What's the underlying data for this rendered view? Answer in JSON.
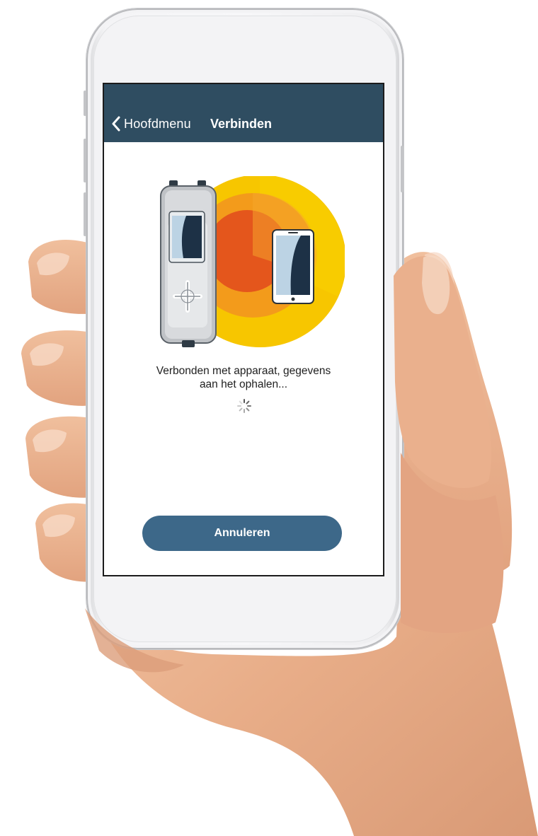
{
  "navbar": {
    "back_label": "Hoofdmenu",
    "title": "Verbinden",
    "background_color": "#2f4d61"
  },
  "main": {
    "status_line_1": "Verbonden met apparaat, gegevens",
    "status_line_2": "aan het ophalen...",
    "cancel_label": "Annuleren",
    "cancel_color": "#3d6889"
  },
  "illustration": {
    "description_icons": [
      "meter-device-icon",
      "smartphone-icon",
      "sun-circle-icon"
    ],
    "colors": {
      "outer": "#f7c600",
      "middle": "#f39b1b",
      "inner": "#e4561c"
    }
  },
  "icons": {
    "back": "chevron-left-icon",
    "loading": "spinner-icon"
  }
}
